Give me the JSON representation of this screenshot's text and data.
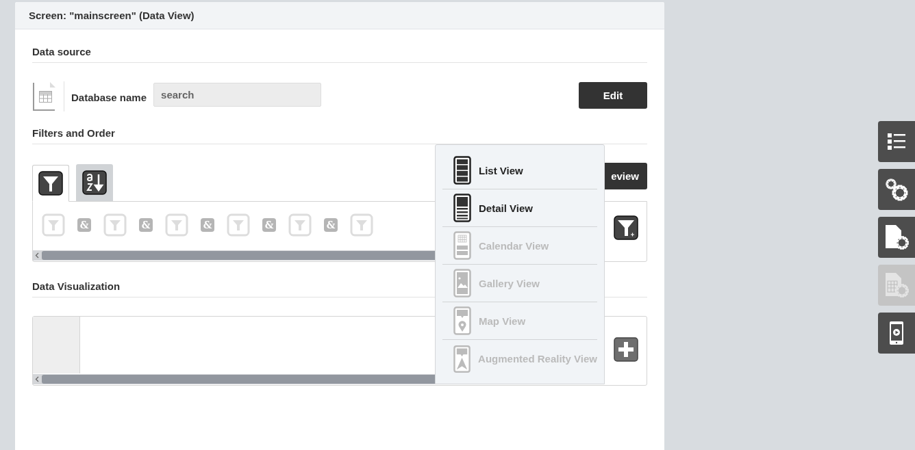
{
  "window": {
    "title": "Screen: \"mainscreen\" (Data View)"
  },
  "data_source": {
    "heading": "Data source",
    "label": "Database name",
    "placeholder": "search",
    "edit_button": "Edit"
  },
  "filters": {
    "heading": "Filters and Order",
    "tabs": [
      {
        "kind": "filter",
        "selected": true
      },
      {
        "kind": "sort",
        "selected": false
      }
    ],
    "preview_button": "eview",
    "chain": [
      {
        "kind": "filter"
      },
      {
        "kind": "and",
        "label": "&"
      },
      {
        "kind": "filter"
      },
      {
        "kind": "and",
        "label": "&"
      },
      {
        "kind": "filter"
      },
      {
        "kind": "and",
        "label": "&"
      },
      {
        "kind": "filter"
      },
      {
        "kind": "and",
        "label": "&"
      },
      {
        "kind": "filter"
      },
      {
        "kind": "and",
        "label": "&"
      },
      {
        "kind": "filter"
      }
    ]
  },
  "visualization": {
    "heading": "Data Visualization"
  },
  "view_menu": [
    {
      "kind": "list",
      "label": "List View",
      "enabled": true
    },
    {
      "kind": "detail",
      "label": "Detail View",
      "enabled": true
    },
    {
      "kind": "calendar",
      "label": "Calendar View",
      "enabled": false
    },
    {
      "kind": "gallery",
      "label": "Gallery View",
      "enabled": false
    },
    {
      "kind": "map",
      "label": "Map View",
      "enabled": false
    },
    {
      "kind": "ar",
      "label": "Augmented Reality View",
      "enabled": false
    }
  ],
  "side_toolbar": [
    {
      "kind": "list",
      "enabled": true
    },
    {
      "kind": "gears",
      "enabled": true
    },
    {
      "kind": "doc-gear",
      "enabled": true
    },
    {
      "kind": "table-gear",
      "enabled": false
    },
    {
      "kind": "phone",
      "enabled": true
    }
  ]
}
